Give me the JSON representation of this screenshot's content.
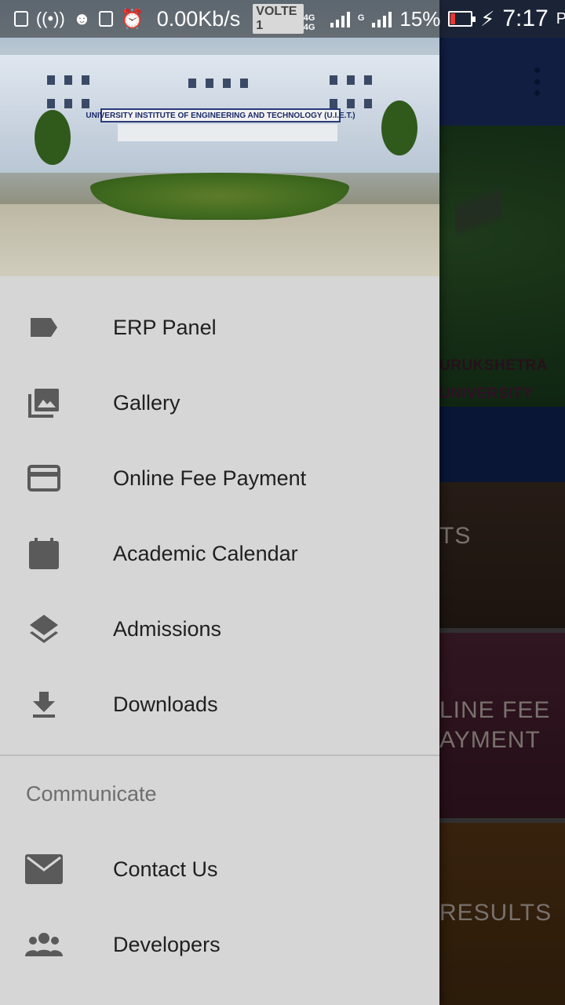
{
  "status_bar": {
    "speed": "0.00Kb/s",
    "volte": "VOLTE 1",
    "network_1": "4G 4G",
    "network_2": "G",
    "battery_percent": "15%",
    "time": "7:17",
    "ampm": "PM",
    "battery_level": 0.15
  },
  "drawer": {
    "header_image": {
      "sign_text": "UNIVERSITY INSTITUTE OF ENGINEERING AND TECHNOLOGY (U.I.E.T.)"
    },
    "menu_items": [
      {
        "label": "ERP Panel",
        "icon": "label-tag-icon"
      },
      {
        "label": "Gallery",
        "icon": "photo-library-icon"
      },
      {
        "label": "Online Fee Payment",
        "icon": "credit-card-icon"
      },
      {
        "label": "Academic Calendar",
        "icon": "calendar-icon"
      },
      {
        "label": "Admissions",
        "icon": "layers-icon"
      },
      {
        "label": "Downloads",
        "icon": "download-icon"
      }
    ],
    "communicate": {
      "title": "Communicate",
      "items": [
        {
          "label": "Contact Us",
          "icon": "mail-icon"
        },
        {
          "label": "Developers",
          "icon": "group-icon"
        }
      ]
    }
  },
  "background": {
    "hero_brand_line1": "URUKSHETRA",
    "hero_brand_line2": "UNIVERSITY",
    "tiles": [
      {
        "label": "TS"
      },
      {
        "label_line1": "LINE FEE",
        "label_line2": "AYMENT"
      },
      {
        "label": "RESULTS"
      }
    ]
  },
  "colors": {
    "drawer_bg": "#d6d6d6",
    "toolbar": "#1b2f66",
    "icon": "#5a5a5a"
  }
}
